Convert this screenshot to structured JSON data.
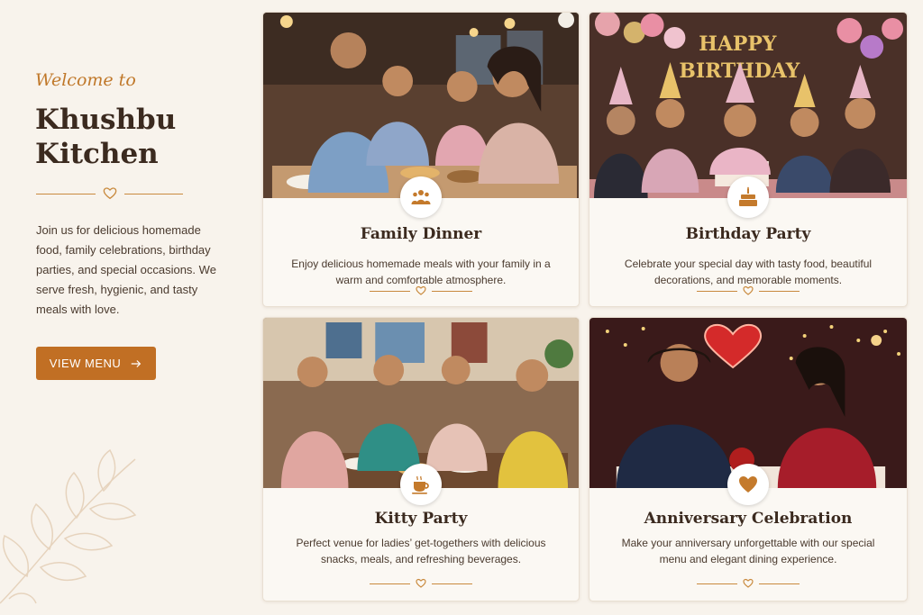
{
  "intro_panel": {
    "welcome": "Welcome to",
    "brand_line1": "Khushbu",
    "brand_line2": "Kitchen",
    "description": "Join us for delicious homemade food, family celebrations, birthday parties, and special occasions. We serve fresh, hygienic, and tasty meals with love.",
    "menu_button": "VIEW MENU",
    "accent_color": "#c16f24"
  },
  "cards": [
    {
      "title": "Family Dinner",
      "description": "Enjoy delicious homemade meals with your family in a warm and comfortable atmosphere.",
      "icon": "family-icon"
    },
    {
      "title": "Birthday Party",
      "description": "Celebrate your special day with tasty food, beautiful decorations, and memorable moments.",
      "icon": "cake-icon",
      "banner": "HAPPY BIRTHDAY"
    },
    {
      "title": "Kitty Party",
      "description": "Perfect venue for ladies’ get-togethers with delicious snacks, meals, and refreshing beverages.",
      "icon": "tea-cup-icon"
    },
    {
      "title": "Anniversary Celebration",
      "description": "Make your anniversary unforgettable with our special menu and elegant dining experience.",
      "icon": "heart-icon"
    }
  ]
}
